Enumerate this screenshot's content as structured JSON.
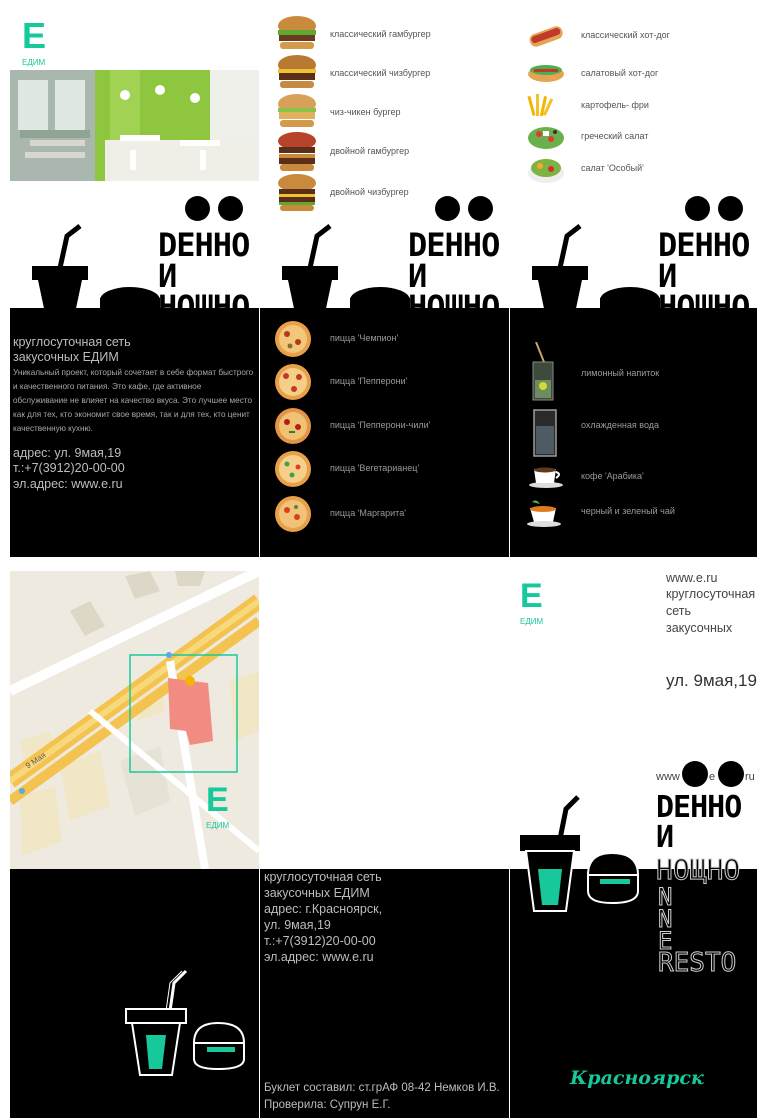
{
  "brand": {
    "logo_letter": "E",
    "logo_text": "ЕДИМ",
    "accent": "#17c99a"
  },
  "slogan": {
    "line1": "DEHHO",
    "line2": "И",
    "line3": "НОЩНО",
    "partial3": "НОЩНО"
  },
  "burgers": [
    {
      "label": "классический гамбургер"
    },
    {
      "label": "классический чизбургер"
    },
    {
      "label": "чиз-чикен бургер"
    },
    {
      "label": "двойной гамбургер"
    },
    {
      "label": "двойной чизбургер"
    }
  ],
  "snacks": [
    {
      "label": "классический хот-дог"
    },
    {
      "label": "салатовый хот-дог"
    },
    {
      "label": "картофель- фри"
    },
    {
      "label": "греческий салат"
    },
    {
      "label": "салат 'Особый'"
    }
  ],
  "pizzas": [
    {
      "label": "пицца 'Чемпион'"
    },
    {
      "label": "пицца 'Пепперони'"
    },
    {
      "label": "пицца 'Пепперони-чили'"
    },
    {
      "label": "пицца 'Вегетарианец'"
    },
    {
      "label": "пицца 'Маргарита'"
    }
  ],
  "drinks": [
    {
      "label": "лимонный напиток"
    },
    {
      "label": "охлажденная вода"
    },
    {
      "label": "кофе 'Арабика'"
    },
    {
      "label": "черный и зеленый чай"
    }
  ],
  "about": {
    "title1": "круглосуточная сеть",
    "title2": "закусочных ЕДИМ",
    "desc": "Уникальный проект, который сочетает в себе формат быстрого и качественного питания. Это кафе, где активное обслуживание не влияет на качество вкуса. Это лучшее место как для тех, кто экономит свое время, так и для тех, кто ценит качественную кухню.",
    "address": "адрес: ул. 9мая,19",
    "phone": "т.:+7(3912)20-00-00",
    "email": "эл.адрес: www.e.ru"
  },
  "map": {
    "street_label": "9 Мая"
  },
  "contacts": {
    "l1": "круглосуточная сеть",
    "l2": "закусочных ЕДИМ",
    "l3": "адрес: г.Красноярск,",
    "l4": "ул. 9мая,19",
    "l5": "т.:+7(3912)20-00-00",
    "l6": "эл.адрес: www.e.ru",
    "credit1": "Буклет составил: ст.грАФ 08-42 Немков И.В.",
    "credit2": "Проверила: Супрун Е.Г."
  },
  "cover": {
    "site": "www.e.ru",
    "l1": "круглосуточная",
    "l2": "сеть",
    "l3": "закусочных",
    "street": "ул. 9мая,19",
    "www_left": "www",
    "www_mid": "e",
    "www_right": "ru",
    "vertical": [
      "N",
      "N",
      "E"
    ],
    "rest": "RESTO",
    "city": "Красноярск"
  }
}
